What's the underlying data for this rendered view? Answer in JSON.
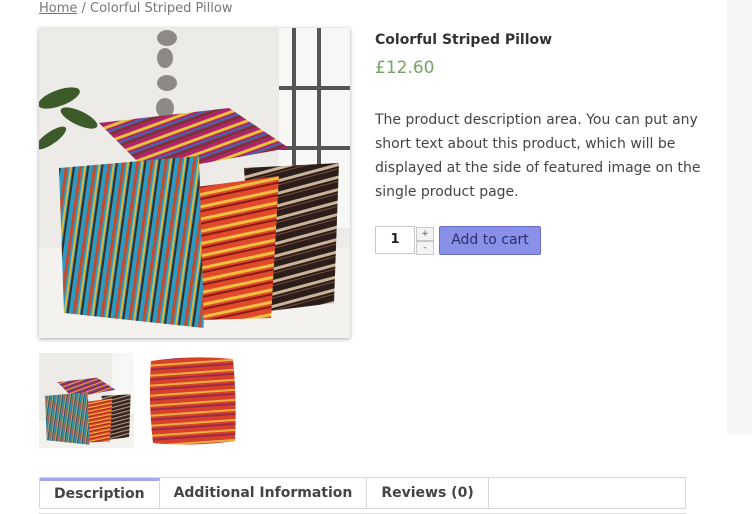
{
  "breadcrumb": {
    "home": "Home",
    "separator": " / ",
    "current": "Colorful Striped Pillow"
  },
  "product": {
    "title": "Colorful Striped Pillow",
    "price": "£12.60",
    "description_lines": [
      "The product description area. You can put any",
      "short text about this product, which will be",
      "displayed at the side of featured image on the",
      "single product page."
    ],
    "quantity": "1",
    "spin_up": "+",
    "spin_down": "-",
    "add_to_cart": "Add to cart"
  },
  "tabs": [
    {
      "label": "Description",
      "active": true
    },
    {
      "label": "Additional Information",
      "active": false
    },
    {
      "label": "Reviews (0)",
      "active": false
    }
  ],
  "colors": {
    "price": "#77a464",
    "button": "#8a8fe8",
    "active_tab": "#a3a8ee"
  }
}
